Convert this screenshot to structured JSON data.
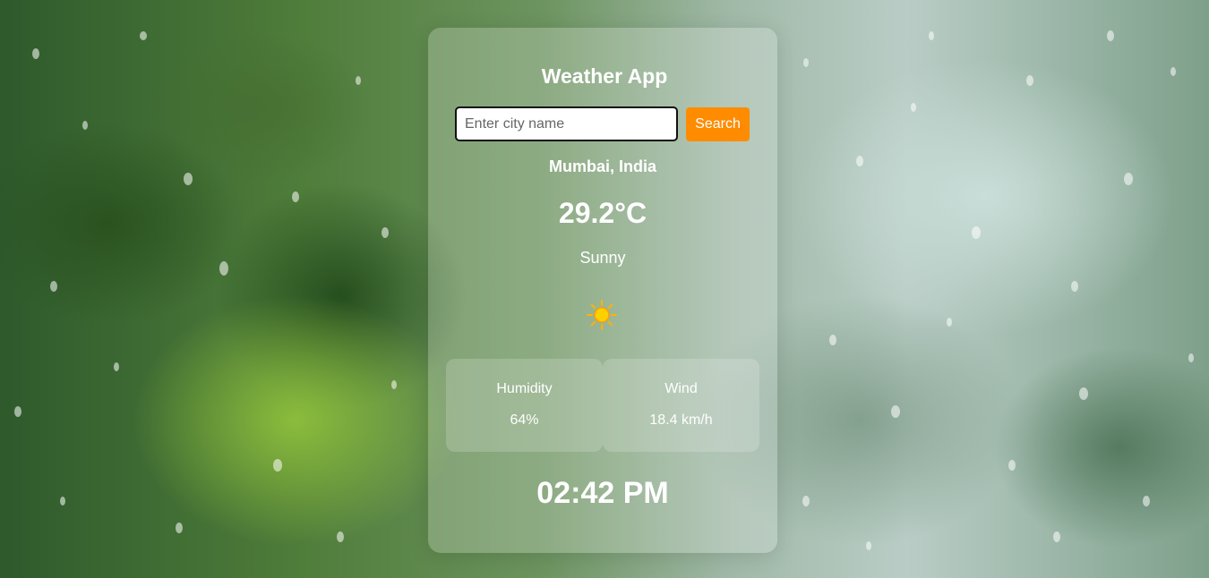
{
  "app": {
    "title": "Weather App"
  },
  "search": {
    "placeholder": "Enter city name",
    "value": "",
    "button_label": "Search",
    "button_color": "#ff8c00"
  },
  "weather": {
    "location": "Mumbai, India",
    "temperature": "29.2°C",
    "condition": "Sunny",
    "condition_icon": "sun-icon"
  },
  "stats": {
    "humidity": {
      "label": "Humidity",
      "value": "64%"
    },
    "wind": {
      "label": "Wind",
      "value": "18.4 km/h"
    }
  },
  "clock": {
    "time": "02:42 PM"
  }
}
